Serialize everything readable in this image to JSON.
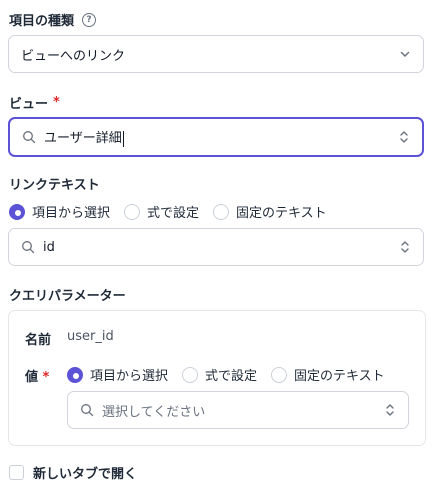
{
  "item_type": {
    "label": "項目の種類",
    "help_icon": "question-circle-icon",
    "value": "ビューへのリンク"
  },
  "view": {
    "label": "ビュー",
    "required_mark": "*",
    "value": "ユーザー詳細"
  },
  "link_text": {
    "label": "リンクテキスト",
    "options": [
      "項目から選択",
      "式で設定",
      "固定のテキスト"
    ],
    "selected": "項目から選択",
    "field_value": "id"
  },
  "query_params": {
    "label": "クエリパラメーター",
    "name_label": "名前",
    "name_value": "user_id",
    "value_label": "値",
    "required_mark": "*",
    "options": [
      "項目から選択",
      "式で設定",
      "固定のテキスト"
    ],
    "selected": "項目から選択",
    "placeholder": "選択してください"
  },
  "new_tab": {
    "label": "新しいタブで開く",
    "checked": false
  },
  "colors": {
    "accent": "#5b52d6",
    "required": "#dc2626",
    "border": "#d1d5db"
  }
}
